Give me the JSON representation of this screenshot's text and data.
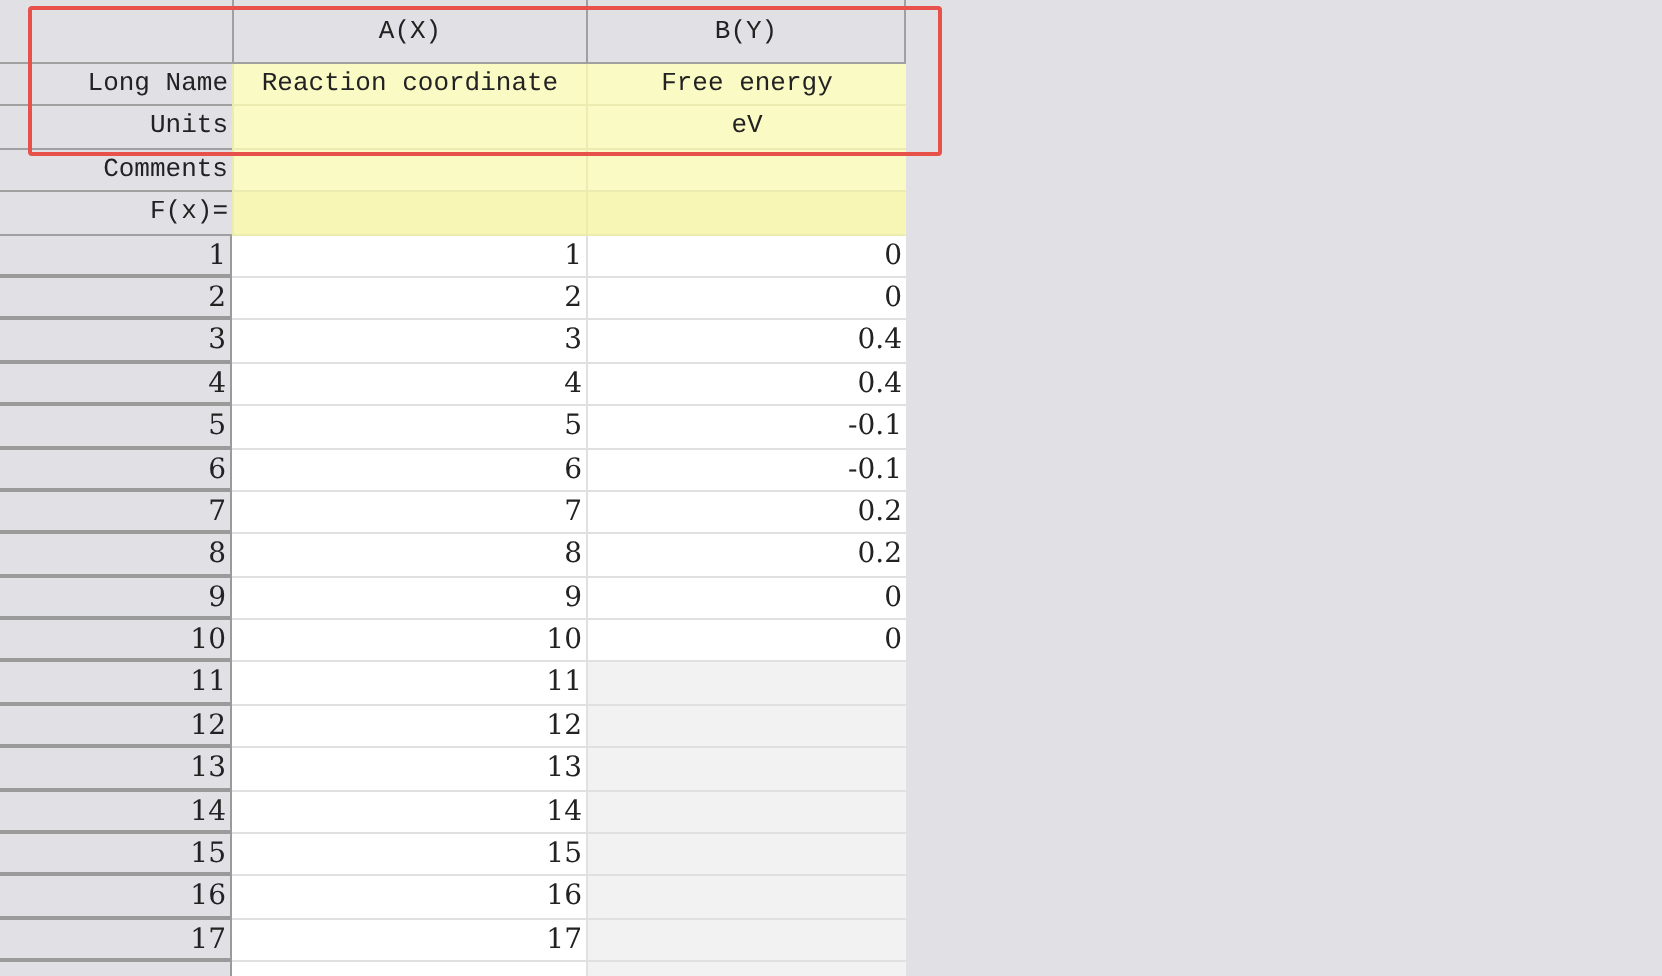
{
  "columns": [
    {
      "header": "A(X)"
    },
    {
      "header": "B(Y)"
    }
  ],
  "label_rows": [
    {
      "label": "Long Name",
      "kind": "label",
      "cells": [
        "Reaction coordinate",
        "Free energy"
      ]
    },
    {
      "label": "Units",
      "kind": "label",
      "cells": [
        null,
        "eV"
      ]
    },
    {
      "label": "Comments",
      "kind": "label"
    },
    {
      "label": "F(x)=",
      "kind": "formula"
    }
  ],
  "rows": [
    {
      "index": "1",
      "a": "1",
      "b": "0"
    },
    {
      "index": "2",
      "a": "2",
      "b": "0"
    },
    {
      "index": "3",
      "a": "3",
      "b": "0.4"
    },
    {
      "index": "4",
      "a": "4",
      "b": "0.4"
    },
    {
      "index": "5",
      "a": "5",
      "b": "-0.1"
    },
    {
      "index": "6",
      "a": "6",
      "b": "-0.1"
    },
    {
      "index": "7",
      "a": "7",
      "b": "0.2"
    },
    {
      "index": "8",
      "a": "8",
      "b": "0.2"
    },
    {
      "index": "9",
      "a": "9",
      "b": "0"
    },
    {
      "index": "10",
      "a": "10",
      "b": "0"
    },
    {
      "index": "11",
      "a": "11"
    },
    {
      "index": "12",
      "a": "12"
    },
    {
      "index": "13",
      "a": "13"
    },
    {
      "index": "14",
      "a": "14"
    },
    {
      "index": "15",
      "a": "15"
    },
    {
      "index": "16",
      "a": "16"
    },
    {
      "index": "17",
      "a": "17"
    }
  ],
  "highlight_box": true
}
